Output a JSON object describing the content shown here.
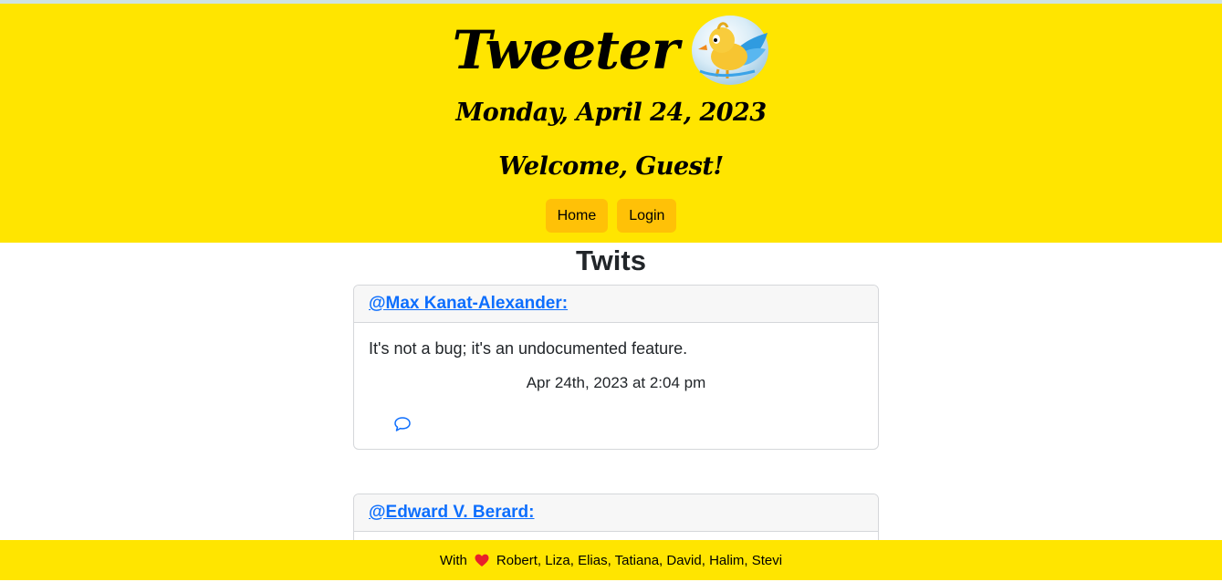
{
  "header": {
    "brand": "Tweeter",
    "logo_icon": "cartoon-bird-logo",
    "date": "Monday, April 24, 2023",
    "welcome": "Welcome, Guest!",
    "nav": [
      {
        "label": "Home"
      },
      {
        "label": "Login"
      }
    ]
  },
  "main": {
    "title": "Twits",
    "twits": [
      {
        "author": "@Max Kanat-Alexander:",
        "text": "It's not a bug; it's an undocumented feature.",
        "time": "Apr 24th, 2023 at 2:04 pm",
        "comment_icon": "speech-bubble-icon"
      },
      {
        "author": "@Edward V. Berard:"
      }
    ]
  },
  "footer": {
    "prefix": "With",
    "heart_icon": "heart-icon",
    "names": "Robert, Liza, Elias, Tatiana, David, Halim, Stevi"
  },
  "colors": {
    "header_bg": "#ffe500",
    "nav_button": "#ffc107",
    "link": "#0d6efd",
    "heart": "#e8202a"
  }
}
